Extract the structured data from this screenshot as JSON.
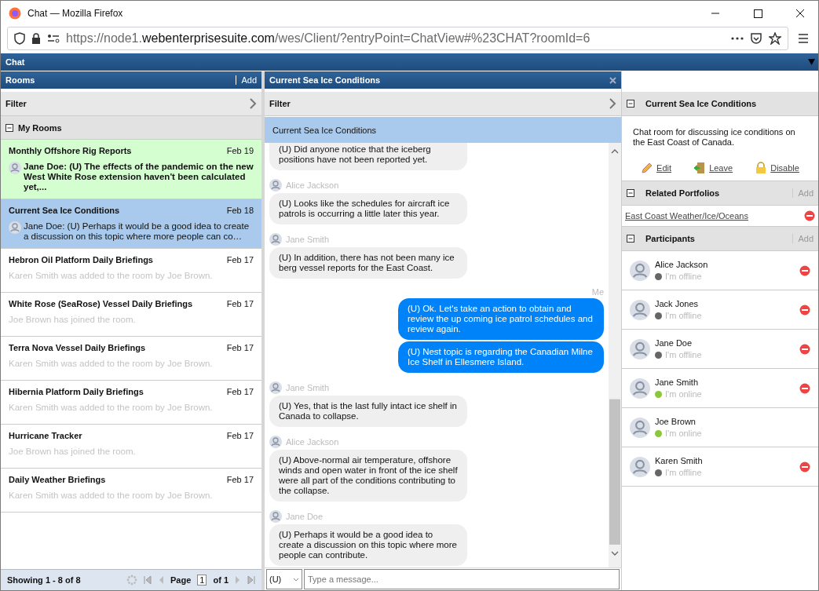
{
  "window": {
    "title": "Chat — Mozilla Firefox"
  },
  "address_bar": {
    "url_start": "https://node1.",
    "url_domain": "webenterprisesuite.com",
    "url_end": "/wes/Client/?entryPoint=ChatView#%23CHAT?roomId=6"
  },
  "app_header": {
    "title": "Chat"
  },
  "rooms_panel": {
    "title": "Rooms",
    "add": "Add",
    "filter": "Filter",
    "group": "My Rooms",
    "rooms": [
      {
        "name": "Monthly Offshore Rig Reports",
        "date": "Feb 19",
        "kind": "message",
        "preview": "Jane Doe: (U) The effects of the pandemic on the new West White Rose extension haven't been calculated yet,...",
        "unread": true,
        "selected": false
      },
      {
        "name": "Current Sea Ice Conditions",
        "date": "Feb 18",
        "kind": "message",
        "preview": "Jane Doe: (U) Perhaps it would be a good idea to create a discussion on this topic where more people can co…",
        "unread": false,
        "selected": true
      },
      {
        "name": "Hebron Oil Platform Daily Briefings",
        "date": "Feb 17",
        "kind": "event",
        "preview": "Karen Smith was added to the room by Joe Brown.",
        "unread": false,
        "selected": false
      },
      {
        "name": "White Rose (SeaRose) Vessel Daily Briefings",
        "date": "Feb 17",
        "kind": "event",
        "preview": "Joe Brown has joined the room.",
        "unread": false,
        "selected": false
      },
      {
        "name": "Terra Nova Vessel Daily Briefings",
        "date": "Feb 17",
        "kind": "event",
        "preview": "Karen Smith was added to the room by Joe Brown.",
        "unread": false,
        "selected": false
      },
      {
        "name": "Hibernia Platform Daily Briefings",
        "date": "Feb 17",
        "kind": "event",
        "preview": "Karen Smith was added to the room by Joe Brown.",
        "unread": false,
        "selected": false
      },
      {
        "name": "Hurricane Tracker",
        "date": "Feb 17",
        "kind": "event",
        "preview": "Joe Brown has joined the room.",
        "unread": false,
        "selected": false
      },
      {
        "name": "Daily Weather Briefings",
        "date": "Feb 17",
        "kind": "event",
        "preview": "Karen Smith was added to the room by Joe Brown.",
        "unread": false,
        "selected": false
      }
    ],
    "footer": {
      "showing": "Showing 1 - 8 of 8",
      "page_label": "Page",
      "page": "1",
      "of": "of 1"
    }
  },
  "chat_panel": {
    "title": "Current Sea Ice Conditions",
    "filter": "Filter",
    "room_bar": "Current Sea Ice Conditions",
    "groups": [
      {
        "kind": "incoming",
        "messages": [
          "(U) Did anyone notice that the iceberg positions have not been reported yet."
        ]
      },
      {
        "kind": "incoming",
        "sender": "Alice Jackson",
        "messages": [
          "(U) Looks like the schedules for aircraft ice patrols is occurring a little later this year."
        ]
      },
      {
        "kind": "incoming",
        "sender": "Jane Smith",
        "messages": [
          "(U) In addition, there has not been many ice berg vessel reports for the East Coast."
        ]
      },
      {
        "kind": "outgoing",
        "sender": "Me",
        "messages": [
          "(U) Ok. Let's take an action to obtain and review the up coming ice patrol schedules and review again.",
          "(U) Nest topic is regarding the Canadian Milne Ice Shelf in Ellesmere Island."
        ]
      },
      {
        "kind": "incoming",
        "sender": "Jane Smith",
        "messages": [
          "(U) Yes, that is the last fully intact ice shelf in Canada to collapse."
        ]
      },
      {
        "kind": "incoming",
        "sender": "Alice Jackson",
        "messages": [
          "(U) Above-normal air temperature, offshore winds and open water in front of the ice shelf were all part of the conditions contributing to the collapse."
        ]
      },
      {
        "kind": "incoming",
        "sender": "Jane Doe",
        "messages": [
          "(U) Perhaps it would be a good idea to create a discussion on this topic where more people can contribute."
        ]
      }
    ],
    "classification": "(U)",
    "message_placeholder": "Type a message..."
  },
  "details_panel": {
    "title": "Current Sea Ice Conditions",
    "description": "Chat room for discussing ice conditions on the East Coast of Canada.",
    "actions": [
      {
        "kind": "edit",
        "label": "Edit"
      },
      {
        "kind": "leave",
        "label": "Leave"
      },
      {
        "kind": "disable",
        "label": "Disable"
      }
    ],
    "portfolios_title": "Related Portfolios",
    "portfolios_add": "Add",
    "portfolios": [
      "East Coast Weather/Ice/Oceans"
    ],
    "participants_title": "Participants",
    "participants_add": "Add",
    "participants": [
      {
        "name": "Alice Jackson",
        "status": "I'm offline",
        "online": false,
        "removable": true
      },
      {
        "name": "Jack Jones",
        "status": "I'm offline",
        "online": false,
        "removable": true
      },
      {
        "name": "Jane Doe",
        "status": "I'm offline",
        "online": false,
        "removable": true
      },
      {
        "name": "Jane Smith",
        "status": "I'm online",
        "online": true,
        "removable": true
      },
      {
        "name": "Joe Brown",
        "status": "I'm online",
        "online": true,
        "removable": false
      },
      {
        "name": "Karen Smith",
        "status": "I'm offline",
        "online": false,
        "removable": true
      }
    ]
  }
}
